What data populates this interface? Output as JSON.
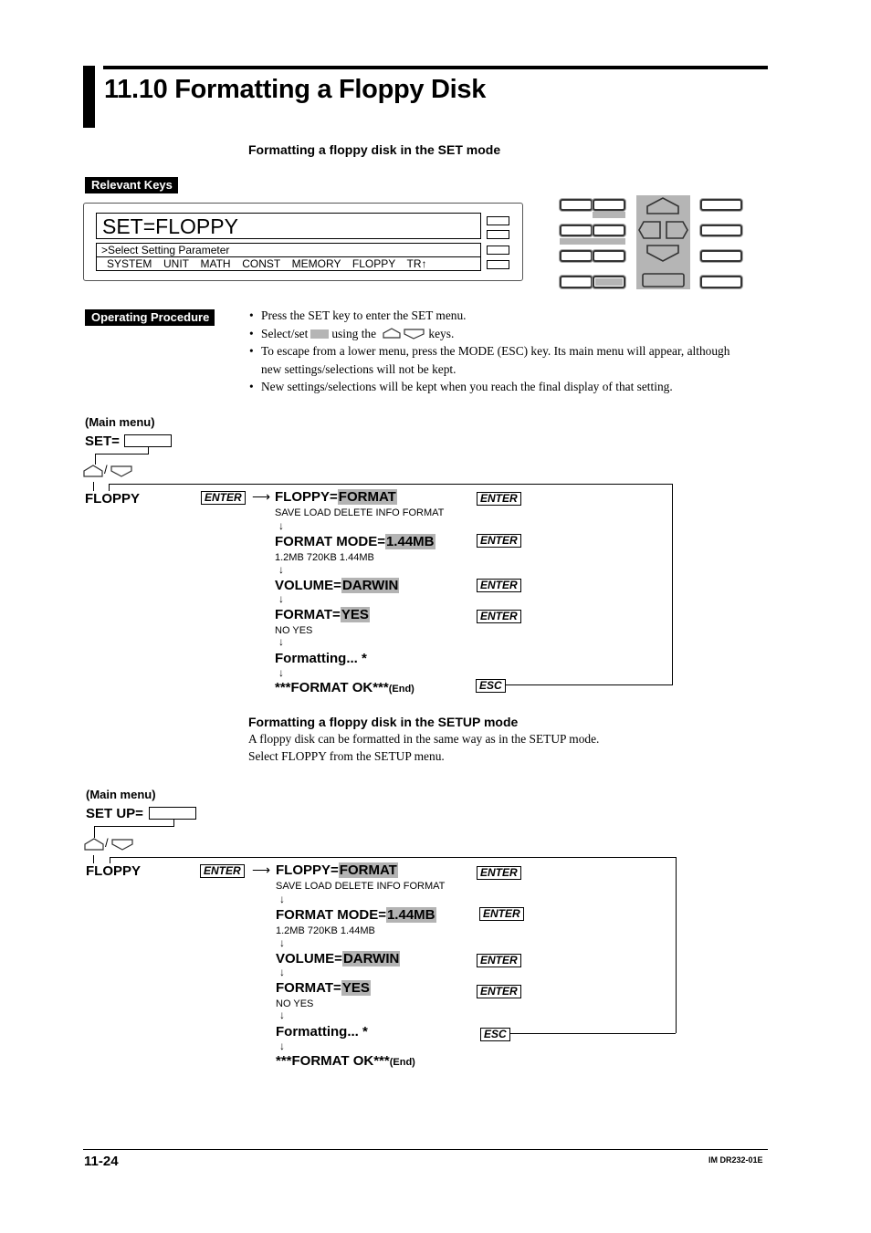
{
  "header": {
    "section_title": "11.10  Formatting a Floppy Disk",
    "set_mode_heading": "Formatting a floppy disk in the SET mode"
  },
  "relevant_keys": {
    "tag": "Relevant Keys",
    "lcd_main": "SET=FLOPPY",
    "lcd_line1": ">Select Setting Parameter",
    "lcd_line2": "SYSTEM  UNIT  MATH  CONST  MEMORY  FLOPPY  TR↑"
  },
  "operating_procedure": {
    "tag": "Operating Procedure",
    "bullets": [
      " Press the SET key to enter the SET menu.",
      "Select/set",
      "using the",
      "keys.",
      "To escape from a lower menu, press the MODE (ESC) key.  Its main menu will appear, although new settings/selections will not be kept.",
      "New settings/selections will be kept when you reach the final display of that setting."
    ]
  },
  "flow_set": {
    "main_menu_label": "(Main menu)",
    "main_prefix": "SET=",
    "slash": "/",
    "item": "FLOPPY",
    "enter": "ENTER",
    "esc": "ESC",
    "steps": [
      {
        "label": "FLOPPY=",
        "value": "FORMAT",
        "options": "SAVE LOAD DELETE INFO FORMAT"
      },
      {
        "label": "FORMAT MODE=",
        "value": "1.44MB",
        "options": "1.2MB 720KB 1.44MB"
      },
      {
        "label": "VOLUME=",
        "value": "DARWIN",
        "options": ""
      },
      {
        "label": "FORMAT=",
        "value": "YES",
        "options": "NO YES"
      }
    ],
    "formatting": "Formatting... *",
    "done": "***FORMAT OK***",
    "end": "(End)"
  },
  "setup_mode": {
    "heading": "Formatting a floppy disk in the SETUP mode",
    "text1": "A floppy disk can be formatted in the same way as in the SETUP mode.",
    "text2": "Select FLOPPY from the SETUP menu."
  },
  "flow_setup": {
    "main_menu_label": "(Main menu)",
    "main_prefix": "SET UP=",
    "slash": "/",
    "item": "FLOPPY",
    "enter": "ENTER",
    "esc": "ESC",
    "steps": [
      {
        "label": "FLOPPY=",
        "value": "FORMAT",
        "options": "SAVE LOAD DELETE INFO FORMAT"
      },
      {
        "label": "FORMAT MODE=",
        "value": "1.44MB",
        "options": "1.2MB 720KB 1.44MB"
      },
      {
        "label": "VOLUME=",
        "value": "DARWIN",
        "options": ""
      },
      {
        "label": "FORMAT=",
        "value": "YES",
        "options": "NO YES"
      }
    ],
    "formatting": "Formatting... *",
    "done": "***FORMAT OK***",
    "end": "(End)"
  },
  "footer": {
    "page_number": "11-24",
    "doc_id": "IM DR232-01E"
  }
}
